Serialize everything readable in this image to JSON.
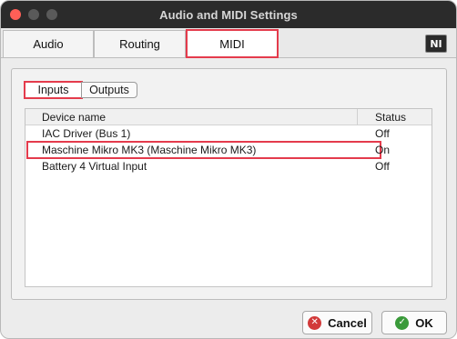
{
  "window": {
    "title": "Audio and MIDI Settings"
  },
  "tabs": [
    {
      "label": "Audio",
      "active": false
    },
    {
      "label": "Routing",
      "active": false
    },
    {
      "label": "MIDI",
      "active": true
    }
  ],
  "brand_logo": {
    "icon": "native-instruments-logo",
    "text": "NI"
  },
  "subtabs": [
    {
      "label": "Inputs",
      "active": true
    },
    {
      "label": "Outputs",
      "active": false
    }
  ],
  "device_list": {
    "columns": [
      "Device name",
      "Status"
    ],
    "rows": [
      {
        "name": "IAC Driver (Bus 1)",
        "status": "Off"
      },
      {
        "name": "Maschine Mikro MK3 (Maschine Mikro MK3)",
        "status": "On"
      },
      {
        "name": "Battery 4 Virtual Input",
        "status": "Off"
      }
    ]
  },
  "buttons": {
    "cancel_label": "Cancel",
    "cancel_icon": "x-circle-icon",
    "ok_label": "OK",
    "ok_icon": "check-circle-icon"
  },
  "colors": {
    "highlight": "#e43b4c",
    "titlebar": "#2b2b2b",
    "cancel_icon": "#d23a3a",
    "ok_icon": "#3a9a3a"
  }
}
